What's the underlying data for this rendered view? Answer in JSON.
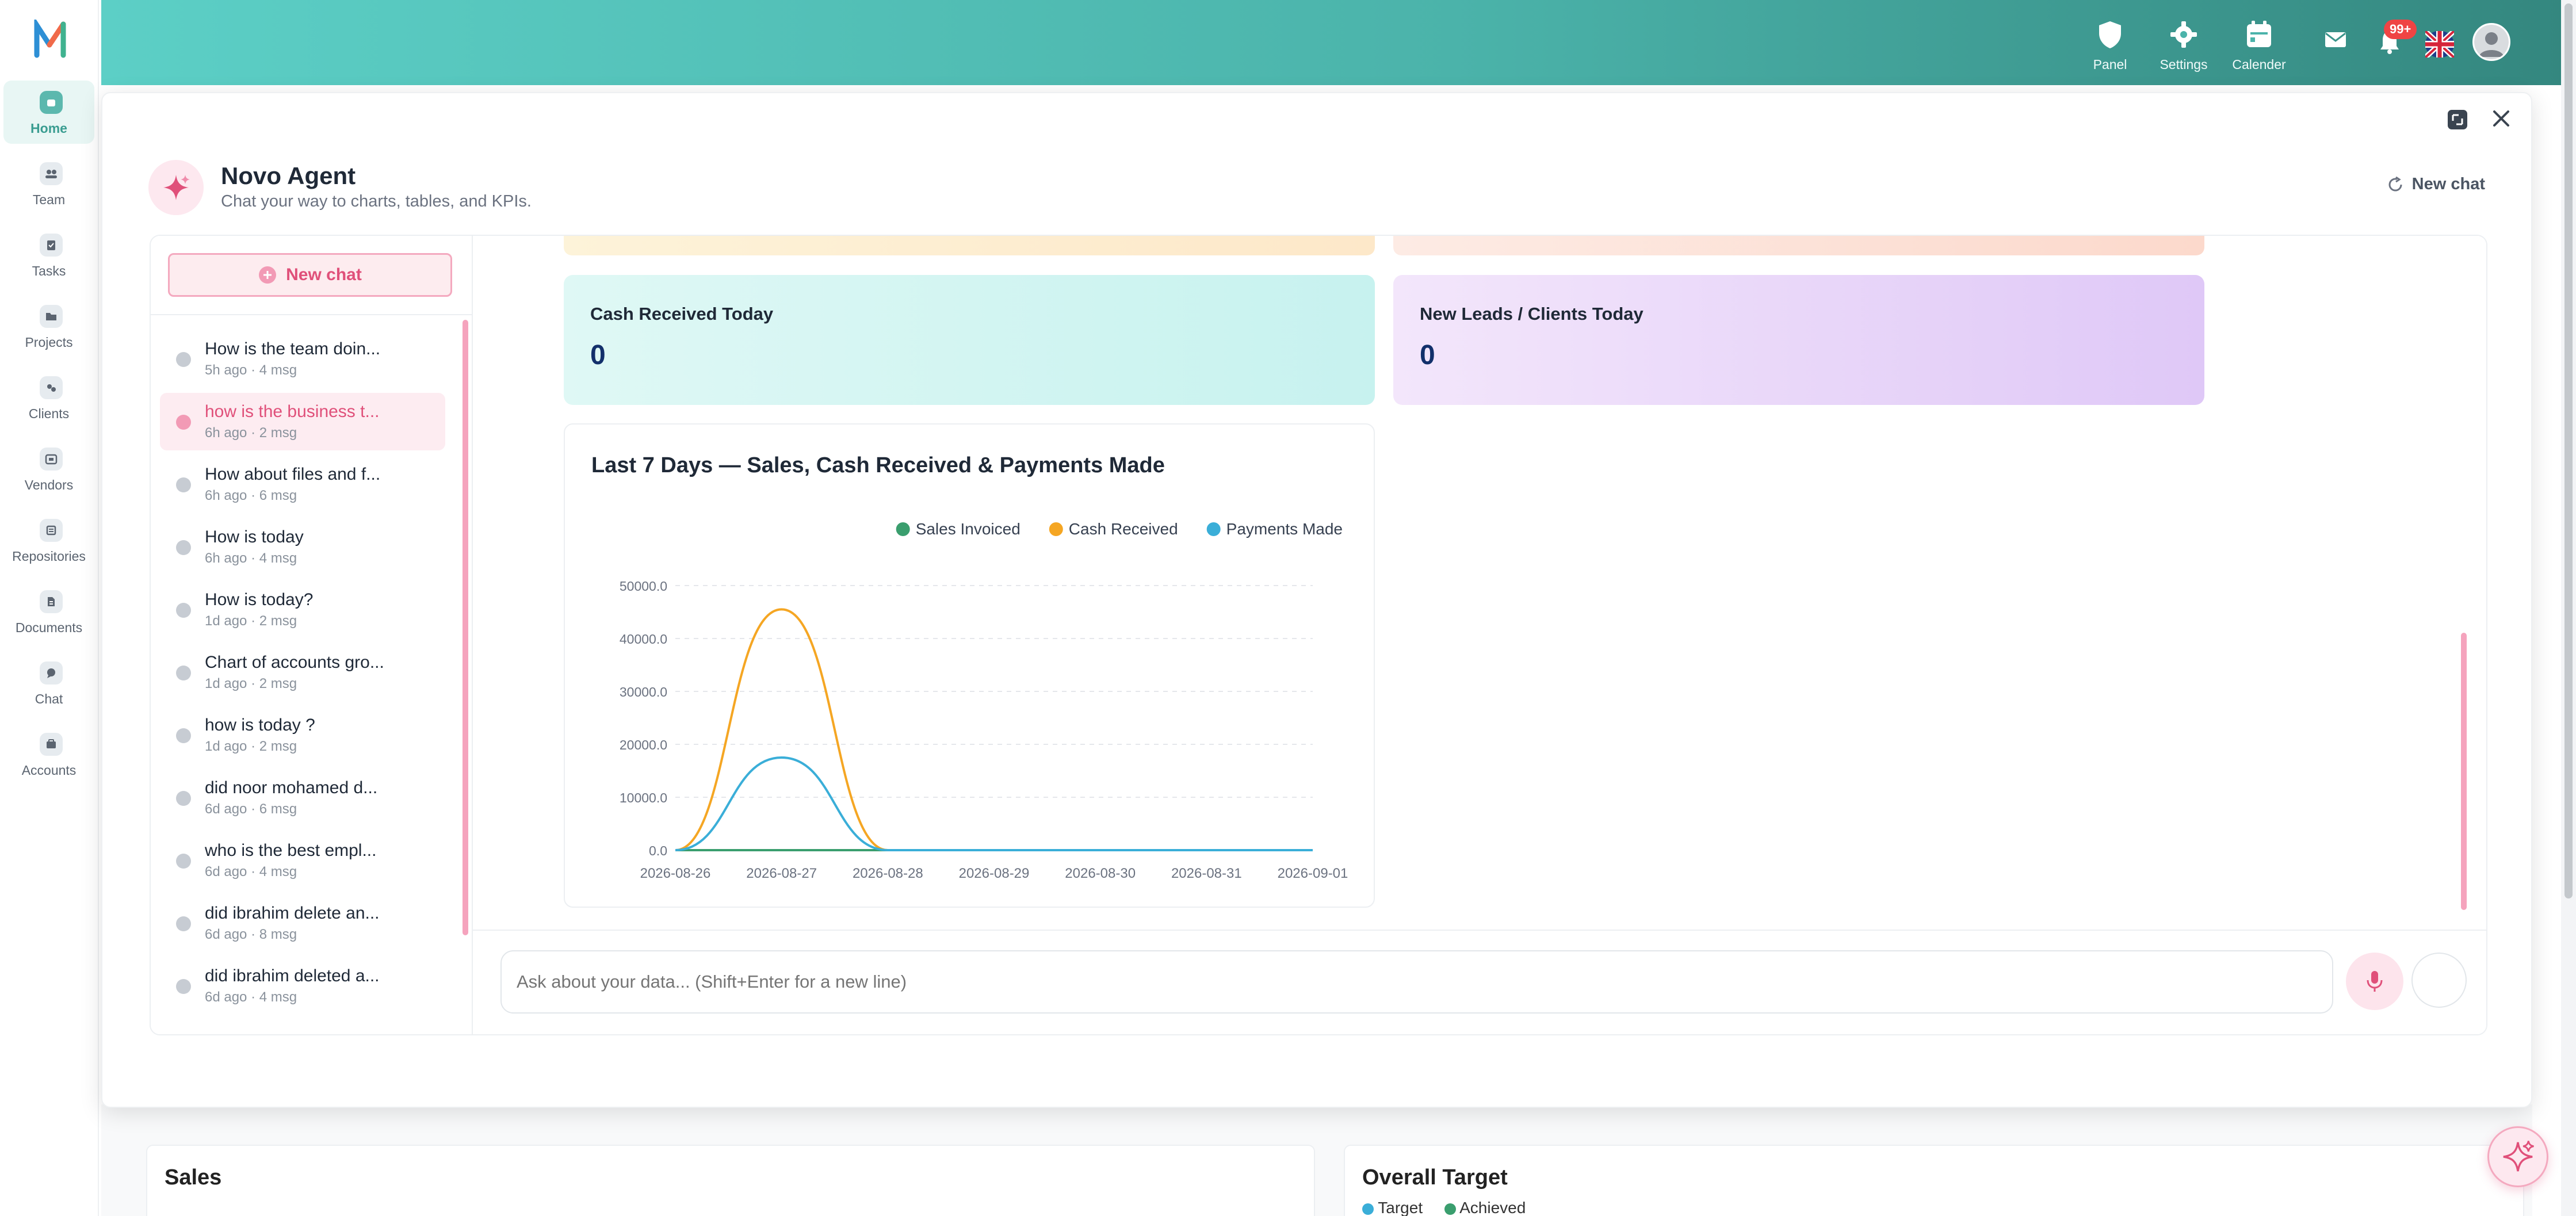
{
  "sidebar": {
    "items": [
      {
        "label": "Home",
        "icon": "home-icon"
      },
      {
        "label": "Team",
        "icon": "team-icon"
      },
      {
        "label": "Tasks",
        "icon": "tasks-icon"
      },
      {
        "label": "Projects",
        "icon": "folder-icon"
      },
      {
        "label": "Clients",
        "icon": "clients-icon"
      },
      {
        "label": "Vendors",
        "icon": "vendors-icon"
      },
      {
        "label": "Repositories",
        "icon": "repository-icon"
      },
      {
        "label": "Documents",
        "icon": "document-icon"
      },
      {
        "label": "Chat",
        "icon": "chat-icon"
      },
      {
        "label": "Accounts",
        "icon": "accounts-icon"
      }
    ],
    "active": "Home"
  },
  "header": {
    "panel_label": "Panel",
    "settings_label": "Settings",
    "calender_label": "Calender",
    "notification_badge": "99+",
    "colors": {
      "accent": "#4bb3aa",
      "brand_pink": "#e0507a"
    }
  },
  "agent": {
    "title": "Novo Agent",
    "subtitle": "Chat your way to charts, tables, and KPIs.",
    "new_chat_top": "New chat",
    "new_chat_button": "New chat",
    "input_placeholder": "Ask about your data... (Shift+Enter for a new line)"
  },
  "history": [
    {
      "title": "How is the team doin...",
      "meta": "5h ago · 4 msg"
    },
    {
      "title": "how is the business t...",
      "meta": "6h ago · 2 msg",
      "active": true
    },
    {
      "title": "How about files and f...",
      "meta": "6h ago · 6 msg"
    },
    {
      "title": "How is today",
      "meta": "6h ago · 4 msg"
    },
    {
      "title": "How is today?",
      "meta": "1d ago · 2 msg"
    },
    {
      "title": "Chart of accounts gro...",
      "meta": "1d ago · 2 msg"
    },
    {
      "title": "how is today ?",
      "meta": "1d ago · 2 msg"
    },
    {
      "title": "did noor mohamed d...",
      "meta": "6d ago · 6 msg"
    },
    {
      "title": "who is the best empl...",
      "meta": "6d ago · 4 msg"
    },
    {
      "title": "did ibrahim delete an...",
      "meta": "6d ago · 8 msg"
    },
    {
      "title": "did ibrahim deleted a...",
      "meta": "6d ago · 4 msg"
    }
  ],
  "kpis": [
    {
      "label": "Cash Received Today",
      "value": "0"
    },
    {
      "label": "New Leads / Clients Today",
      "value": "0"
    }
  ],
  "chart_data": {
    "type": "line",
    "title": "Last 7 Days — Sales, Cash Received & Payments Made",
    "x": [
      "2026-08-26",
      "2026-08-27",
      "2026-08-28",
      "2026-08-29",
      "2026-08-30",
      "2026-08-31",
      "2026-09-01"
    ],
    "y_ticks": [
      "0.0",
      "10000.0",
      "20000.0",
      "30000.0",
      "40000.0",
      "50000.0"
    ],
    "ylim": [
      0,
      50000
    ],
    "series": [
      {
        "name": "Sales Invoiced",
        "color": "#3a9e6e",
        "values": [
          0,
          0,
          0,
          0,
          0,
          0,
          0
        ]
      },
      {
        "name": "Cash Received",
        "color": "#f5a623",
        "values": [
          0,
          45500,
          0,
          0,
          0,
          0,
          0
        ]
      },
      {
        "name": "Payments Made",
        "color": "#3aaed8",
        "values": [
          0,
          17500,
          0,
          0,
          0,
          0,
          0
        ]
      }
    ],
    "legend": "top-right",
    "grid": true
  },
  "background_page": {
    "sales_title": "Sales",
    "target_title": "Overall Target",
    "target_legend": [
      "Target",
      "Achieved"
    ]
  }
}
